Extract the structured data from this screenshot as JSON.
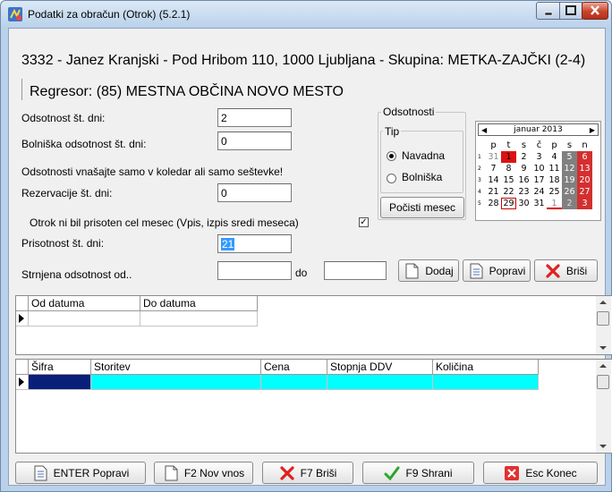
{
  "window": {
    "title": "Podatki za obračun (Otrok)  (5.2.1)"
  },
  "header": {
    "line1": "3332 - Janez Kranjski - Pod Hribom 110, 1000 Ljubljana - Skupina: METKA-ZAJČKI (2-4)",
    "line2": "Regresor: (85) MESTNA OBČINA NOVO MESTO"
  },
  "form": {
    "odsotnost_label": "Odsotnost št. dni:",
    "odsotnost_value": "2",
    "bolniska_label": "Bolniška odsotnost št. dni:",
    "bolniska_value": "0",
    "hint": "Odsotnosti vnašajte samo v koledar ali samo seštevke!",
    "rezervacije_label": "Rezervacije št. dni:",
    "rezervacije_value": "0",
    "otrok_label": "Otrok ni bil prisoten cel mesec (Vpis,  izpis sredi meseca)",
    "otrok_checked": true,
    "prisotnost_label": "Prisotnost  št. dni:",
    "prisotnost_value": "21",
    "strnjena_label": "Strnjena odsotnost od..",
    "do_label": "do",
    "od_value": "",
    "do_value": ""
  },
  "odsotnosti": {
    "group_title": "Odsotnosti",
    "tip_title": "Tip",
    "options": [
      "Navadna",
      "Bolniška"
    ],
    "selected": "Navadna",
    "clear_button": "Počisti mesec"
  },
  "calendar": {
    "month_label": "januar 2013",
    "day_headers": [
      "p",
      "t",
      "s",
      "č",
      "p",
      "s",
      "n"
    ],
    "weeks": [
      {
        "num": "1",
        "days": [
          "31",
          "1",
          "2",
          "3",
          "4",
          "5",
          "6"
        ]
      },
      {
        "num": "2",
        "days": [
          "7",
          "8",
          "9",
          "10",
          "11",
          "12",
          "13"
        ]
      },
      {
        "num": "3",
        "days": [
          "14",
          "15",
          "16",
          "17",
          "18",
          "19",
          "20"
        ]
      },
      {
        "num": "4",
        "days": [
          "21",
          "22",
          "23",
          "24",
          "25",
          "26",
          "27"
        ]
      },
      {
        "num": "5",
        "days": [
          "28",
          "29",
          "30",
          "31",
          "1",
          "2",
          "3"
        ]
      }
    ]
  },
  "actions": {
    "dodaj": "Dodaj",
    "popravi": "Popravi",
    "brisi": "Briši"
  },
  "dates_grid": {
    "columns": [
      "Od datuma",
      "Do datuma"
    ]
  },
  "services_grid": {
    "columns": [
      "Šifra",
      "Storitev",
      "Cena",
      "Stopnja DDV",
      "Količina"
    ]
  },
  "footer": {
    "enter_popravi": "ENTER Popravi",
    "f2_nov_vnos": "F2 Nov vnos",
    "f7_brisi": "F7 Briši",
    "f9_shrani": "F9 Shrani",
    "esc_konec": "Esc Konec"
  },
  "colors": {
    "selected_row_key": "#0a1f7a",
    "selected_row": "#00ffff",
    "calendar_weekend": "#808080",
    "calendar_absence": "#dd1111"
  }
}
